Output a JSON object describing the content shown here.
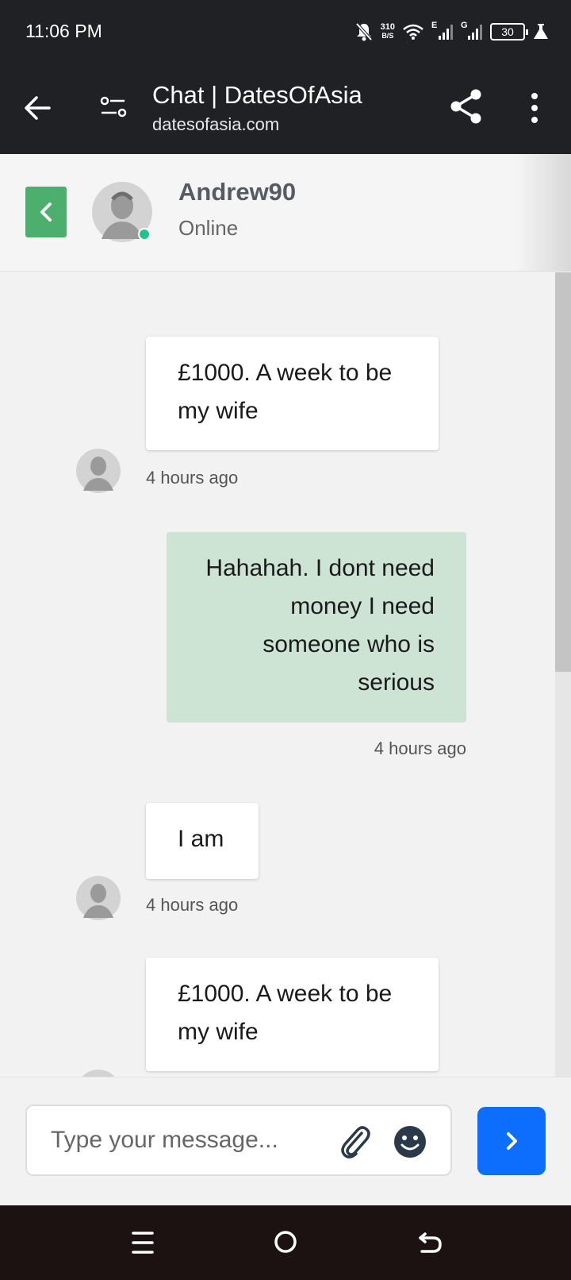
{
  "status_bar": {
    "time": "11:06 PM",
    "net_speed_value": "310",
    "net_speed_unit": "B/S",
    "signal1_label": "E",
    "signal2_label": "G",
    "battery": "30",
    "icons": [
      "bell-off-icon",
      "wifi-icon",
      "signal-icon",
      "battery-icon",
      "flask-icon"
    ]
  },
  "browser": {
    "title": "Chat | DatesOfAsia",
    "url": "datesofasia.com",
    "icons": [
      "back-arrow-icon",
      "tune-icon",
      "share-icon",
      "more-vert-icon"
    ]
  },
  "chat_header": {
    "name": "Andrew90",
    "status": "Online",
    "accent_color": "#4caf6e",
    "online_color": "#22c38e"
  },
  "messages": [
    {
      "direction": "in",
      "text": "£1000. A week to be my wife",
      "time": "4 hours ago"
    },
    {
      "direction": "out",
      "text": "Hahahah. I dont need money I need someone who is serious",
      "time": "4 hours ago"
    },
    {
      "direction": "in",
      "text": "I am",
      "time": "4 hours ago"
    },
    {
      "direction": "in",
      "text": "£1000. A week to be my wife",
      "time": ""
    }
  ],
  "composer": {
    "placeholder": "Type your message...",
    "send_color": "#0d6efd",
    "icons": [
      "paperclip-icon",
      "emoji-icon",
      "chevron-right-icon"
    ]
  },
  "nav_bar": {
    "icons": [
      "menu-icon",
      "home-icon",
      "back-icon"
    ]
  }
}
